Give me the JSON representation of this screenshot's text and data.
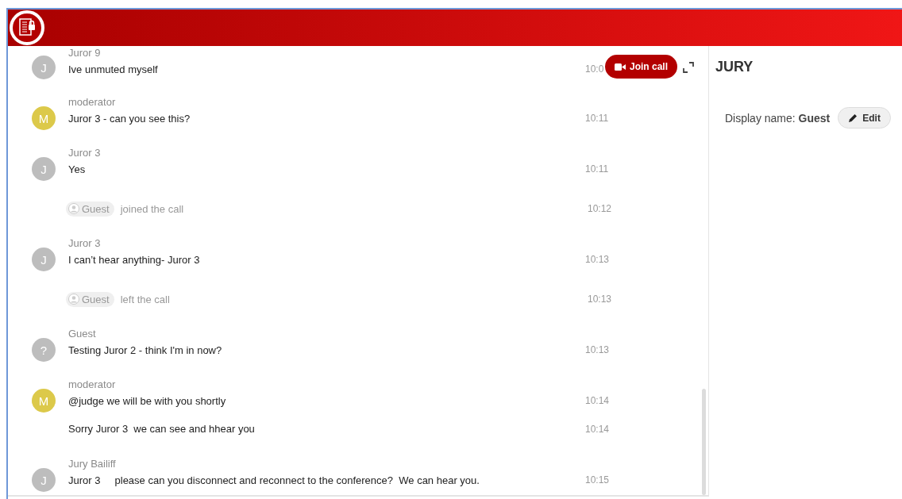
{
  "chat": {
    "items": [
      {
        "kind": "message",
        "sender": "Juror 9",
        "avatar": "J",
        "color": "#bdbdbd",
        "lines": [
          {
            "text": "Ive unmuted myself",
            "time": "10:0"
          }
        ]
      },
      {
        "kind": "message",
        "sender": "moderator",
        "avatar": "M",
        "color": "#dcc94a",
        "lines": [
          {
            "text": "Juror 3 - can you see this?",
            "time": "10:11"
          }
        ]
      },
      {
        "kind": "message",
        "sender": "Juror 3",
        "avatar": "J",
        "color": "#bdbdbd",
        "lines": [
          {
            "text": "Yes",
            "time": "10:11"
          }
        ]
      },
      {
        "kind": "event",
        "name": "Guest",
        "text": "joined the call",
        "time": "10:12"
      },
      {
        "kind": "message",
        "sender": "Juror 3",
        "avatar": "J",
        "color": "#bdbdbd",
        "lines": [
          {
            "text": "I can’t hear anything- Juror 3",
            "time": "10:13"
          }
        ]
      },
      {
        "kind": "event",
        "name": "Guest",
        "text": "left the call",
        "time": "10:13"
      },
      {
        "kind": "message",
        "sender": "Guest",
        "avatar": "?",
        "color": "#bdbdbd",
        "lines": [
          {
            "text": "Testing Juror 2 - think I'm in now?",
            "time": "10:13"
          }
        ]
      },
      {
        "kind": "message",
        "sender": "moderator",
        "avatar": "M",
        "color": "#dcc94a",
        "lines": [
          {
            "text": "@judge we will be with you shortly",
            "time": "10:14"
          },
          {
            "text": "Sorry Juror 3  we can see and hhear you",
            "time": "10:14"
          }
        ]
      },
      {
        "kind": "message",
        "sender": "Jury Bailiff",
        "avatar": "J",
        "color": "#bdbdbd",
        "lines": [
          {
            "text": "Juror 3     please can you disconnect and reconnect to the conference?  We can hear you.",
            "time": "10:15"
          }
        ]
      }
    ],
    "join_button": "Join call"
  },
  "side": {
    "title": "JURY",
    "display_label": "Display name:",
    "display_name": "Guest",
    "edit_button": "Edit"
  }
}
